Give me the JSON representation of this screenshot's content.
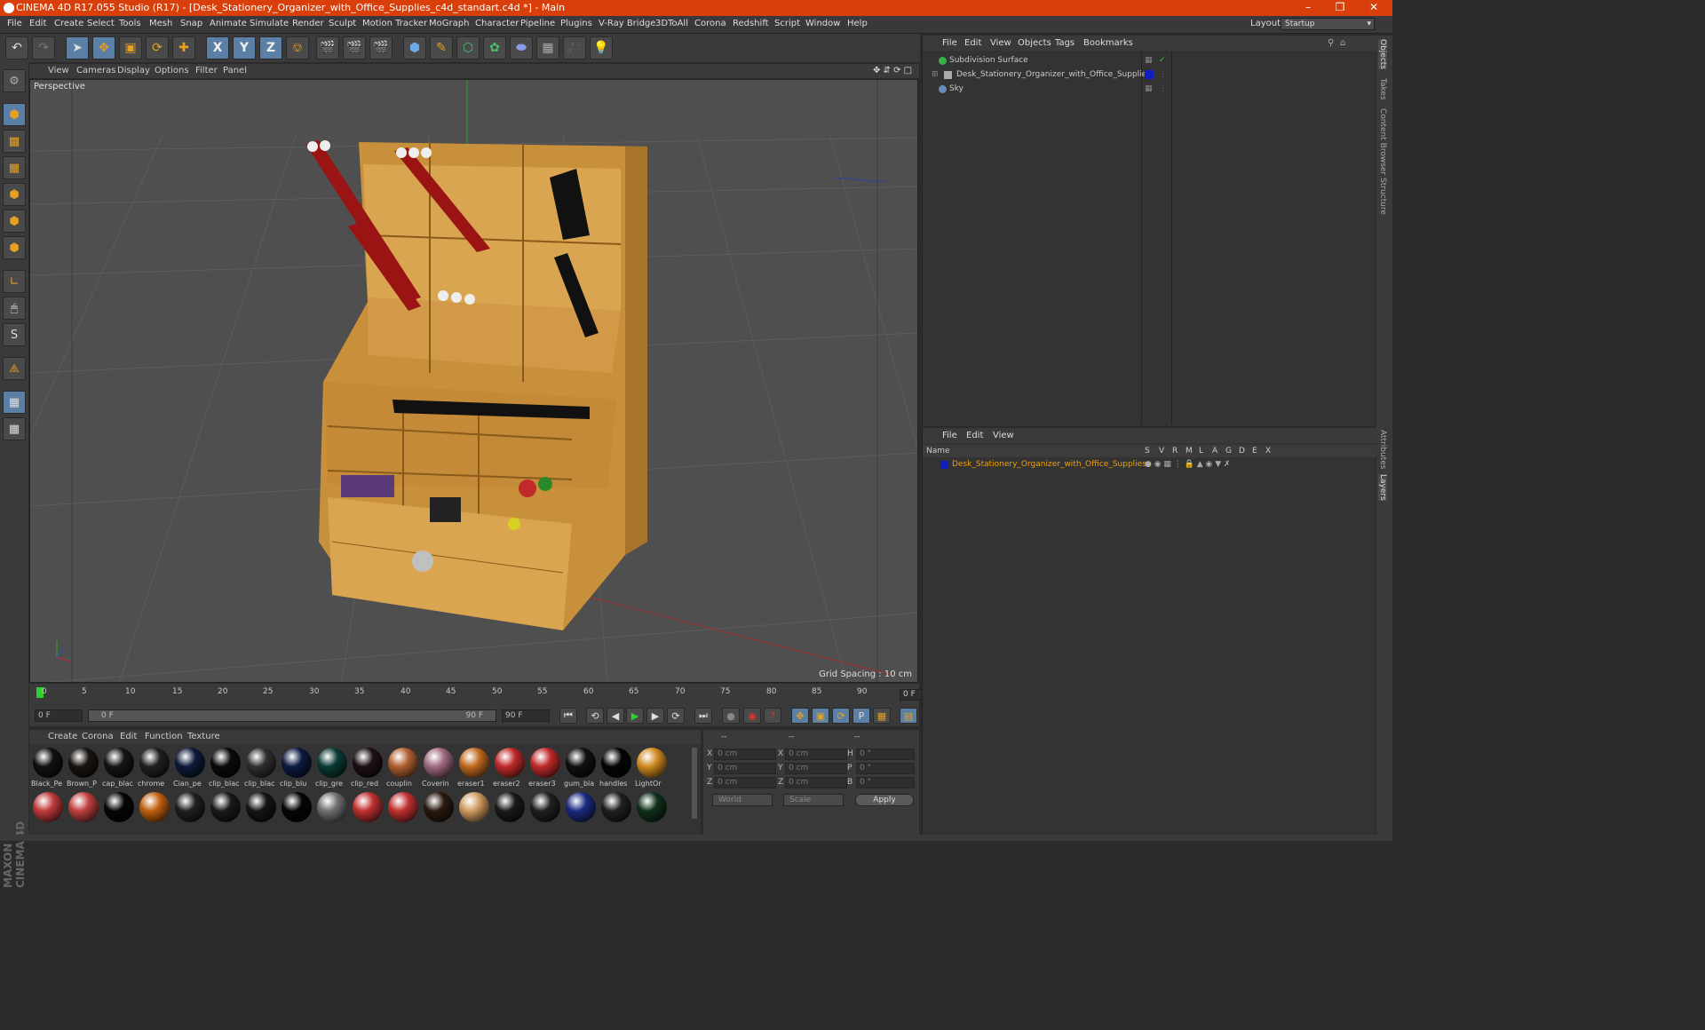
{
  "window": {
    "title": "CINEMA 4D R17.055 Studio (R17) - [Desk_Stationery_Organizer_with_Office_Supplies_c4d_standart.c4d *] - Main"
  },
  "menubar": {
    "items": [
      "File",
      "Edit",
      "Create",
      "Select",
      "Tools",
      "Mesh",
      "Snap",
      "Animate",
      "Simulate",
      "Render",
      "Sculpt",
      "Motion Tracker",
      "MoGraph",
      "Character",
      "Pipeline",
      "Plugins",
      "V-Ray Bridge",
      "3DToAll",
      "Corona",
      "Redshift",
      "Script",
      "Window",
      "Help"
    ],
    "layout_label": "Layout:",
    "layout_value": "Startup"
  },
  "viewport": {
    "menu": [
      "View",
      "Cameras",
      "Display",
      "Options",
      "Filter",
      "Panel"
    ],
    "camera_label": "Perspective",
    "grid_spacing": "Grid Spacing : 10 cm"
  },
  "timeline": {
    "ticks": [
      "0",
      "5",
      "10",
      "15",
      "20",
      "25",
      "30",
      "35",
      "40",
      "45",
      "50",
      "55",
      "60",
      "65",
      "70",
      "75",
      "80",
      "85",
      "90"
    ],
    "current_frame": "0 F"
  },
  "transport": {
    "start_field": "0 F",
    "range_start": "0 F",
    "range_end": "90 F",
    "end_field": "90 F"
  },
  "material_manager": {
    "menu": [
      "Create",
      "Corona",
      "Edit",
      "Function",
      "Texture"
    ],
    "row1": [
      {
        "name": "Black_Pe",
        "color": "#111111"
      },
      {
        "name": "Brown_P",
        "color": "#1a1410"
      },
      {
        "name": "cap_blac",
        "color": "#151515"
      },
      {
        "name": "chrome",
        "color": "#202020"
      },
      {
        "name": "Cian_pe",
        "color": "#0c1a3a"
      },
      {
        "name": "clip_blac",
        "color": "#0a0a0a"
      },
      {
        "name": "clip_blac",
        "color": "#303030"
      },
      {
        "name": "clip_blu",
        "color": "#0d1a40"
      },
      {
        "name": "clip_gre",
        "color": "#0b3a34"
      },
      {
        "name": "clip_red",
        "color": "#1c1016"
      },
      {
        "name": "couplin",
        "color": "#b06030"
      },
      {
        "name": "Coverin",
        "color": "#a06a80"
      },
      {
        "name": "eraser1",
        "color": "#c06a20"
      },
      {
        "name": "eraser2",
        "color": "#c02a2a"
      },
      {
        "name": "eraser3",
        "color": "#c02a2a"
      },
      {
        "name": "gum_bla",
        "color": "#101010"
      },
      {
        "name": "handles",
        "color": "#050505"
      },
      {
        "name": "LightOr",
        "color": "#d08a20"
      }
    ],
    "row2_colors": [
      "#c03a3a",
      "#c04040",
      "#050505",
      "#c06010",
      "#202020",
      "#1a1a1a",
      "#151515",
      "#050505",
      "#707070",
      "#c03030",
      "#c03030",
      "#2a1a10",
      "#d09a60",
      "#1a1a1a",
      "#202020",
      "#1a2a80",
      "#202020",
      "#10301a"
    ]
  },
  "coordinates": {
    "header": [
      "--",
      "--",
      "--"
    ],
    "rows": [
      {
        "a": "X",
        "a_val": "0 cm",
        "b": "X",
        "b_val": "0 cm",
        "c": "H",
        "c_val": "0 °"
      },
      {
        "a": "Y",
        "a_val": "0 cm",
        "b": "Y",
        "b_val": "0 cm",
        "c": "P",
        "c_val": "0 °"
      },
      {
        "a": "Z",
        "a_val": "0 cm",
        "b": "Z",
        "b_val": "0 cm",
        "c": "B",
        "c_val": "0 °"
      }
    ],
    "mode_select": "World",
    "type_select": "Scale",
    "apply_label": "Apply"
  },
  "object_manager": {
    "menu": [
      "File",
      "Edit",
      "View",
      "Objects",
      "Tags",
      "Bookmarks"
    ],
    "objects": [
      {
        "name": "Subdivision Surface",
        "icon_color": "#3ab04a"
      },
      {
        "name": "Desk_Stationery_Organizer_with_Office_Supplies",
        "icon_color": "#aaaaaa",
        "tag_color": "#1020c0"
      },
      {
        "name": "Sky",
        "icon_color": "#6a8aba"
      }
    ]
  },
  "layer_manager": {
    "menu": [
      "File",
      "Edit",
      "View"
    ],
    "columns": [
      "Name",
      "S",
      "V",
      "R",
      "M",
      "L",
      "A",
      "G",
      "D",
      "E",
      "X"
    ],
    "layer_name": "Desk_Stationery_Organizer_with_Office_Supplies",
    "layer_color": "#1020c0"
  },
  "side_tabs": [
    "Objects",
    "Takes",
    "Content Browser",
    "Structure",
    "Attributes",
    "Layers"
  ]
}
